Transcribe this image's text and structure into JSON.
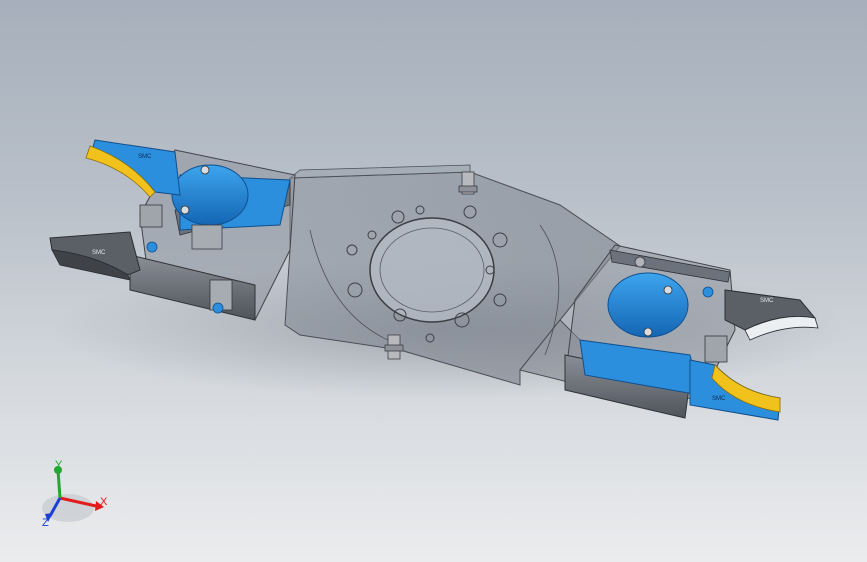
{
  "viewport": {
    "background_top": "#a6afbb",
    "background_bottom": "#ebecee"
  },
  "model": {
    "body_color": "#7c838e",
    "part_blue": "#1f86d6",
    "part_yellow": "#f1c21b",
    "finger_gray": "#575b62",
    "jaw_label_left": "SMC",
    "jaw_label_right": "SMC"
  },
  "triad": {
    "x_label": "X",
    "y_label": "Y",
    "z_label": "Z",
    "x_color": "#e31b1b",
    "y_color": "#23a733",
    "z_color": "#1a3fd6"
  }
}
